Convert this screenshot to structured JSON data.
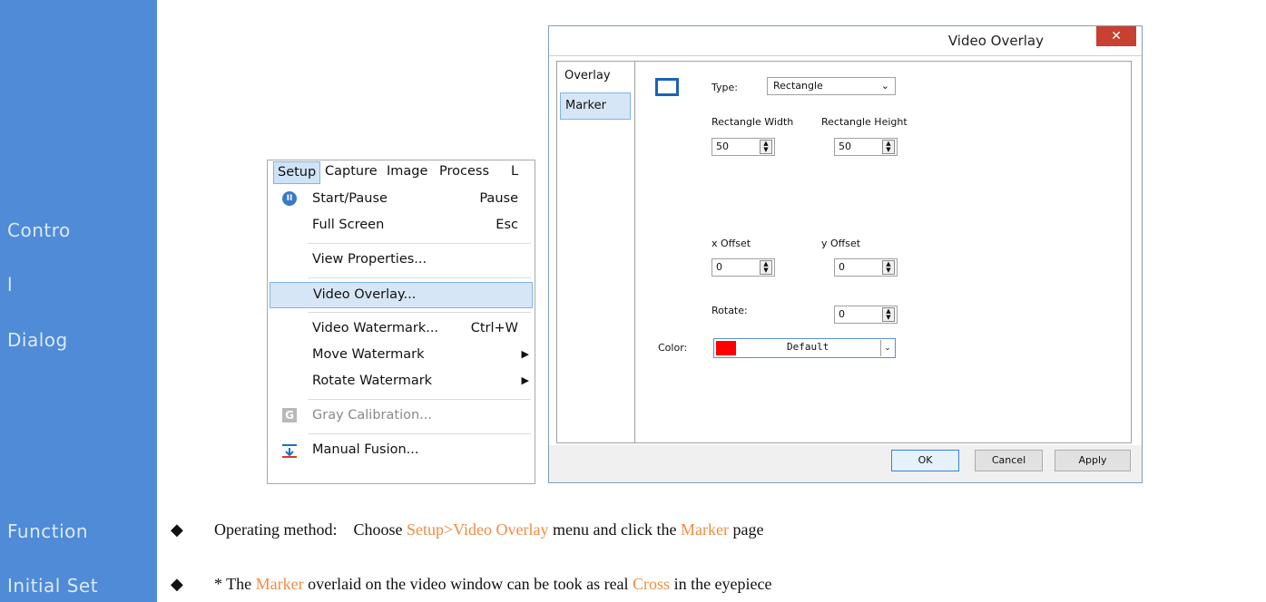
{
  "sidebar": {
    "labels": [
      "Contro",
      "l",
      "Dialog",
      "Function",
      "Initial Set"
    ],
    "color": "#4f8bd6"
  },
  "menu": {
    "bar": [
      "Setup",
      "Capture",
      "Image",
      "Process",
      "L"
    ],
    "items": [
      {
        "label": "Start/Pause",
        "shortcut": "Pause",
        "icon": "pause-icon"
      },
      {
        "label": "Full Screen",
        "shortcut": "Esc"
      },
      {
        "label": "View Properties..."
      },
      {
        "label": "Video Overlay..."
      },
      {
        "label": "Video Watermark...",
        "shortcut": "Ctrl+W"
      },
      {
        "label": "Move Watermark",
        "submenu": "▶"
      },
      {
        "label": "Rotate Watermark",
        "submenu": "▶"
      },
      {
        "label": "Gray Calibration...",
        "icon": "gray-calibration-icon",
        "icon_letter": "G"
      },
      {
        "label": "Manual Fusion...",
        "icon": "manual-fusion-icon"
      }
    ]
  },
  "dialog": {
    "title": "Video Overlay",
    "close": "✕",
    "tabs": [
      "Overlay",
      "Marker"
    ],
    "type_label": "Type:",
    "type_value": "Rectangle",
    "rect_width_label": "Rectangle Width",
    "rect_height_label": "Rectangle Height",
    "rect_width": "50",
    "rect_height": "50",
    "x_offset_label": "x Offset",
    "y_offset_label": "y Offset",
    "x_offset": "0",
    "y_offset": "0",
    "rotate_label": "Rotate:",
    "rotate": "0",
    "color_label": "Color:",
    "color_value": "Default",
    "color_swatch": "#ff0000",
    "buttons": {
      "ok": "OK",
      "cancel": "Cancel",
      "apply": "Apply"
    }
  },
  "bullets": [
    {
      "marker": "◆",
      "parts": [
        {
          "text": "Operating method:    Choose ",
          "accent": false
        },
        {
          "text": "Setup>Video Overlay",
          "accent": true
        },
        {
          "text": " menu and click the ",
          "accent": false
        },
        {
          "text": "Marker",
          "accent": true
        },
        {
          "text": " page",
          "accent": false
        }
      ]
    },
    {
      "marker": "◆",
      "parts": [
        {
          "text": "* The ",
          "accent": false
        },
        {
          "text": "Marker",
          "accent": true
        },
        {
          "text": " overlaid on the video window can be took as real ",
          "accent": false
        },
        {
          "text": "Cross",
          "accent": true
        },
        {
          "text": " in the eyepiece",
          "accent": false
        }
      ]
    }
  ],
  "accent_color": "#ef8c45"
}
